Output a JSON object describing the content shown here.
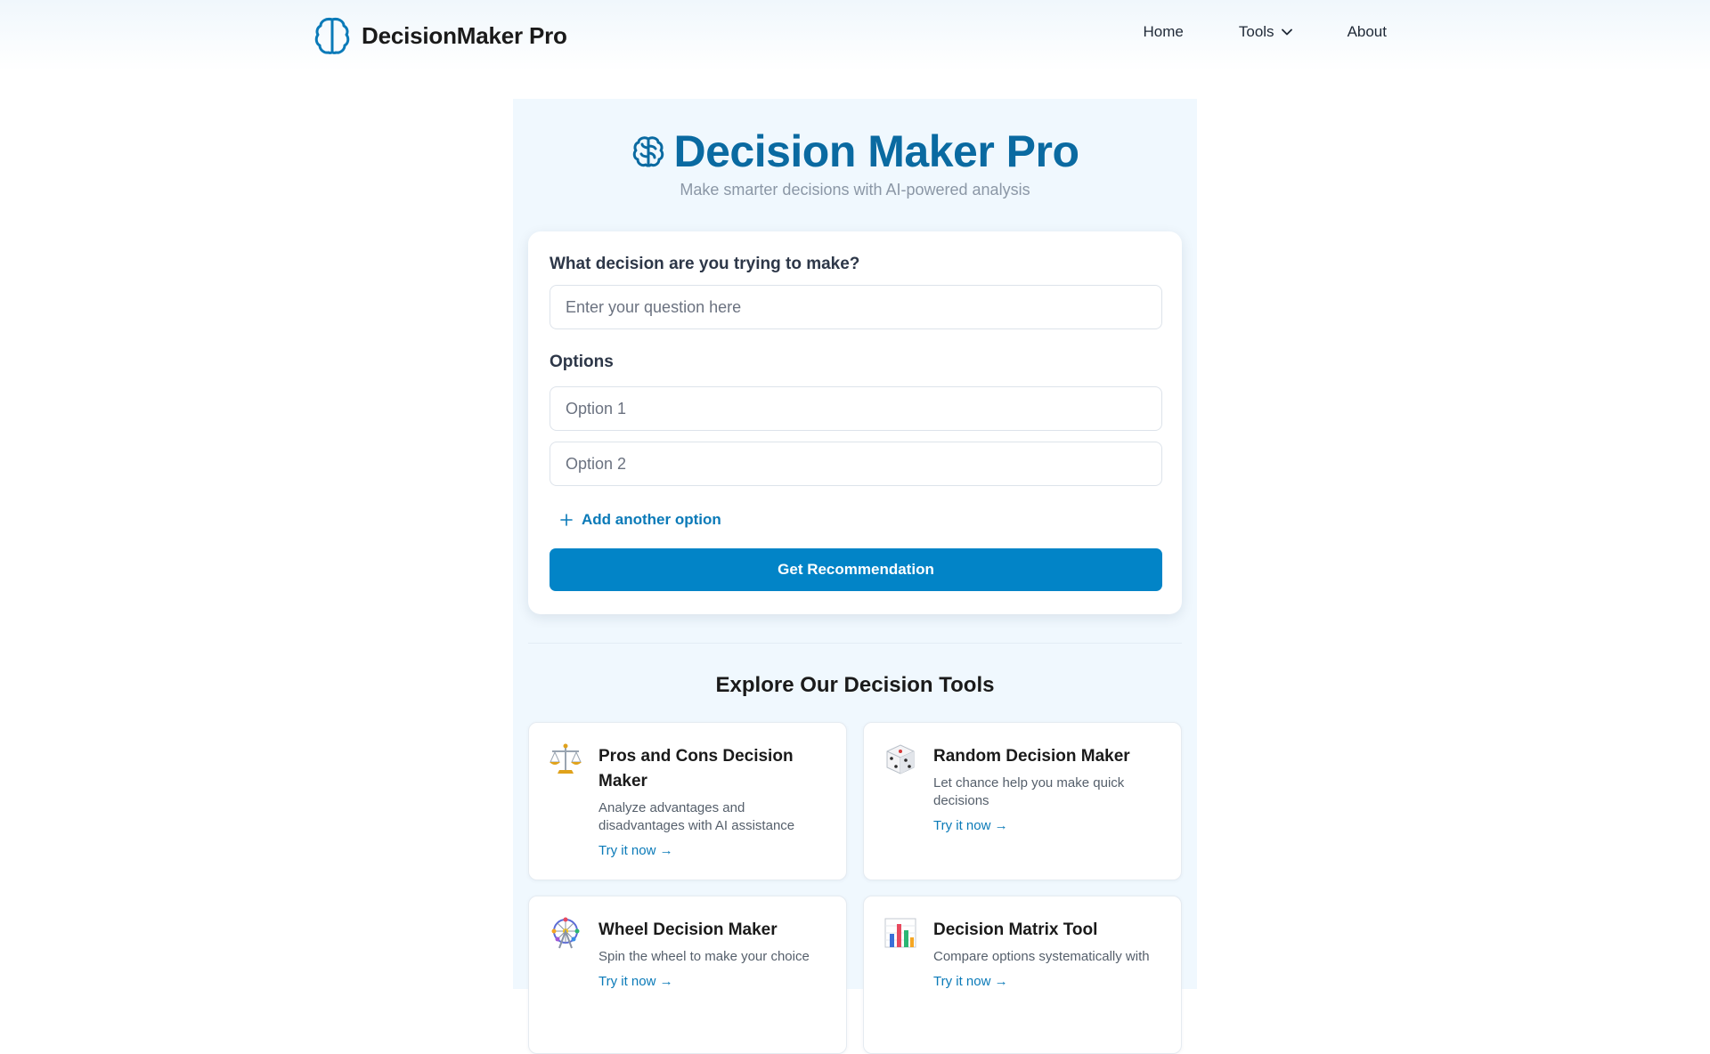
{
  "header": {
    "brand": "DecisionMaker Pro",
    "brand_icon": "brain-icon",
    "nav": [
      {
        "label": "Home"
      },
      {
        "label": "Tools",
        "icon": "chevron-down-icon"
      },
      {
        "label": "About"
      }
    ]
  },
  "hero": {
    "title": "Decision Maker Pro",
    "subtitle": "Make smarter decisions with AI-powered analysis",
    "icon": "brain-icon"
  },
  "form": {
    "question_label": "What decision are you trying to make?",
    "question_placeholder": "Enter your question here",
    "question_value": "",
    "options_label": "Options",
    "options": [
      {
        "placeholder": "Option 1",
        "value": ""
      },
      {
        "placeholder": "Option 2",
        "value": ""
      }
    ],
    "add_option_label": "Add another option",
    "submit_label": "Get Recommendation"
  },
  "tools_section": {
    "title": "Explore Our Decision Tools",
    "cards": [
      {
        "title": "Pros and Cons Decision Maker",
        "description": "Analyze advantages and disadvantages with AI assistance",
        "link": "Try it now →",
        "icon": "balance-scale-icon"
      },
      {
        "title": "Random Decision Maker",
        "description": "Let chance help you make quick decisions",
        "link": "Try it now →",
        "icon": "dice-icon"
      },
      {
        "title": "Wheel Decision Maker",
        "description": "Spin the wheel to make your choice",
        "link": "Try it now →",
        "icon": "ferris-wheel-icon"
      },
      {
        "title": "Decision Matrix Tool",
        "description": "Compare options systematically with",
        "link": "Try it now →",
        "icon": "bar-chart-icon"
      }
    ]
  },
  "colors": {
    "accent": "#0284c7",
    "title_blue": "#0a6aa1",
    "panel_bg": "#f0f8fe"
  }
}
